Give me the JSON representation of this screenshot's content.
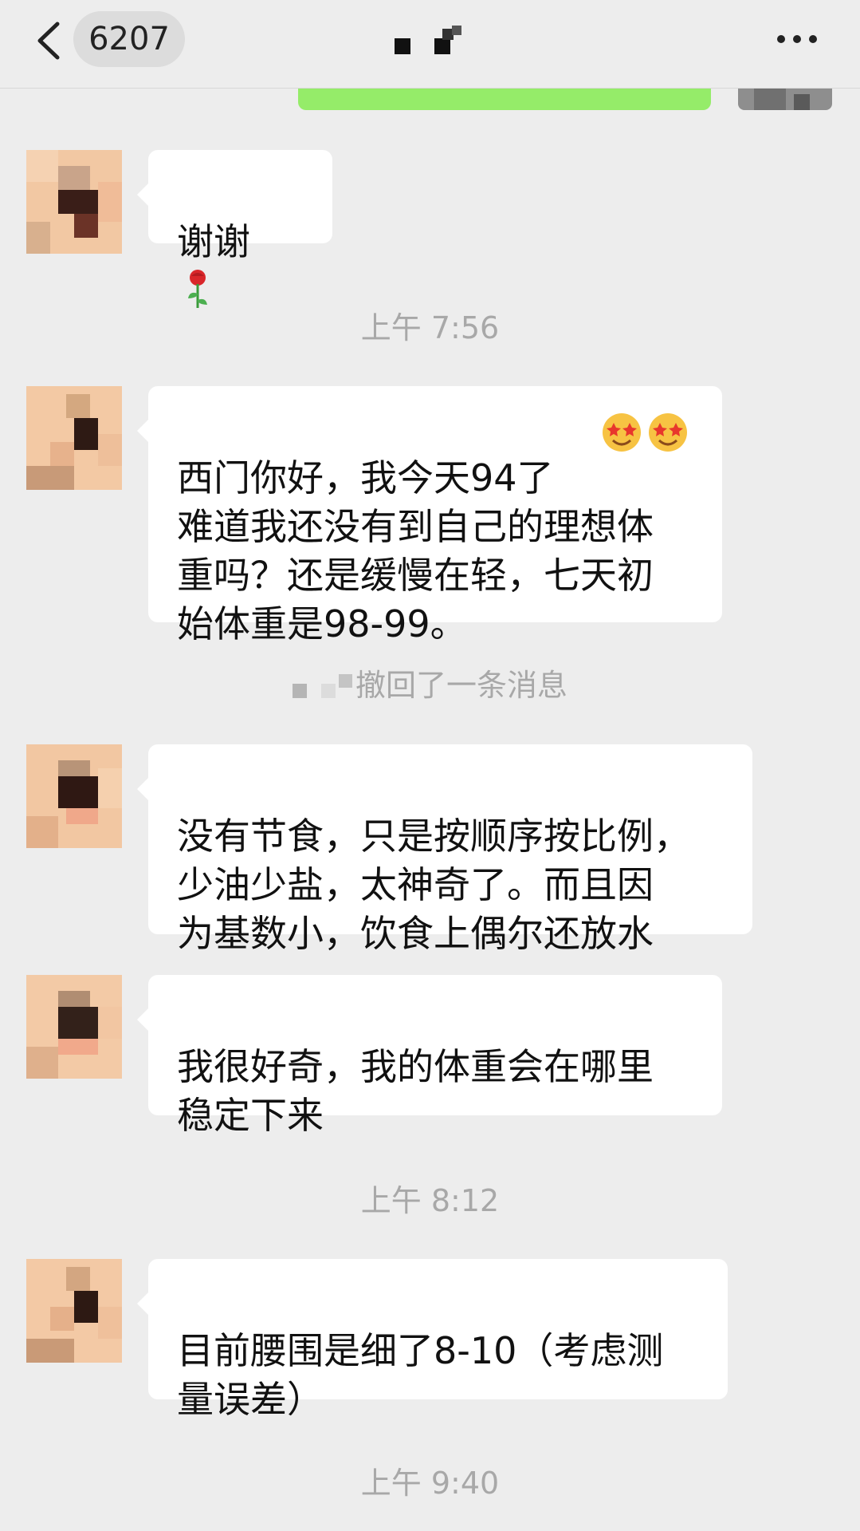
{
  "header": {
    "unread_count": "6207",
    "title": "",
    "back_icon": "chevron-left-icon",
    "more_icon": "more-dots-icon"
  },
  "messages": [
    {
      "id": "m1",
      "text": "谢谢",
      "emoji": "rose-icon"
    },
    {
      "id": "m2",
      "text": "西门你好，我今天94了\n难道我还没有到自己的理想体\n重吗？还是缓慢在轻，七天初\n始体重是98-99。",
      "emoji": "star-struck-icon"
    },
    {
      "id": "m3",
      "text": "没有节食，只是按顺序按比例，\n少油少盐，太神奇了。而且因\n为基数小，饮食上偶尔还放水"
    },
    {
      "id": "m4",
      "text": "我很好奇，我的体重会在哪里\n稳定下来"
    },
    {
      "id": "m5",
      "text": "目前腰围是细了8-10（考虑测\n量误差）"
    }
  ],
  "timestamps": {
    "t1": "上午 7:56",
    "t2": "上午 8:12",
    "t3": "上午 9:40"
  },
  "system": {
    "recall_text": "撤回了一条消息"
  },
  "colors": {
    "background": "#ededed",
    "bubble": "#ffffff",
    "sent_bubble": "#95ec69",
    "meta_text": "#a8a8a8"
  }
}
